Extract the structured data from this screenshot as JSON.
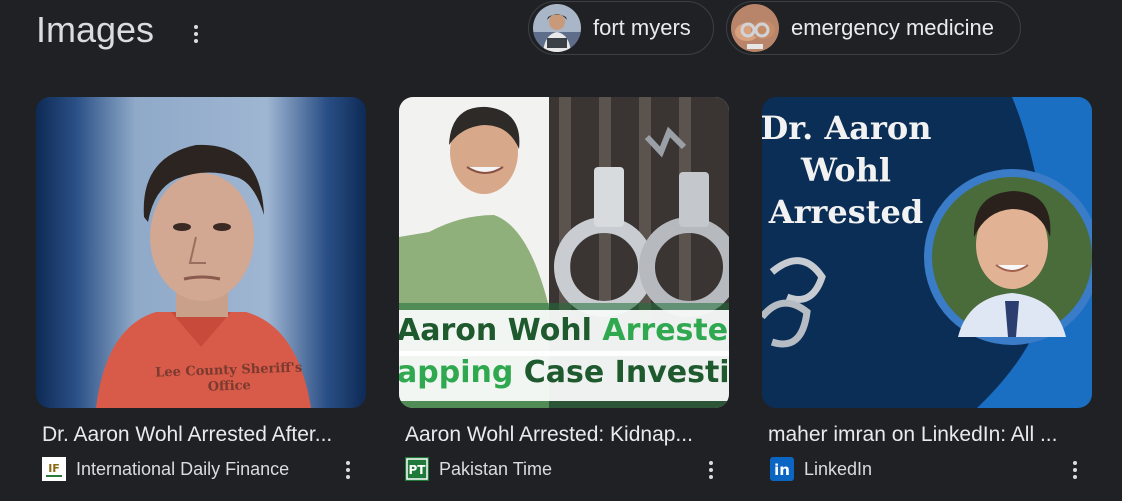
{
  "section": {
    "title": "Images"
  },
  "chips": [
    {
      "label": "fort myers"
    },
    {
      "label": "emergency medicine"
    }
  ],
  "results": [
    {
      "caption": "Dr. Aaron Wohl Arrested After...",
      "source": "International Daily Finance",
      "image_text": "Lee County Sheriff's Office"
    },
    {
      "caption": "Aaron Wohl Arrested: Kidnap...",
      "source": "Pakistan Time",
      "image_text": {
        "line1_a": "Aaron Wohl ",
        "line1_b": "Arreste",
        "line2_a": "apping ",
        "line2_b": "Case Investi"
      }
    },
    {
      "caption": "maher imran on LinkedIn: All ...",
      "source": "LinkedIn",
      "image_text": {
        "line1": "Dr. Aaron",
        "line2": "Wohl",
        "line3": "Arrested"
      }
    }
  ],
  "icons": {
    "section_menu": "more-vert-icon",
    "favicon1": "idf-logo-icon",
    "favicon2": "pt-logo-icon",
    "favicon3": "linkedin-logo-icon"
  },
  "colors": {
    "background": "#202124",
    "text": "#e8eaed",
    "green_accent": "#2fa84f",
    "linkedin_blue": "#0a66c2"
  }
}
